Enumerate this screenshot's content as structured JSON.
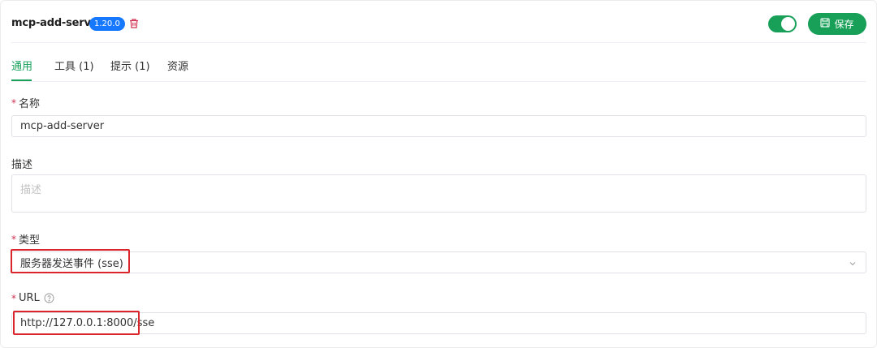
{
  "header": {
    "server_name": "mcp-add-server",
    "version": "1.20.0",
    "save_label": "保存",
    "enabled": true
  },
  "tabs": [
    {
      "label": "通用",
      "active": true
    },
    {
      "label": "工具 (1)",
      "active": false
    },
    {
      "label": "提示 (1)",
      "active": false
    },
    {
      "label": "资源",
      "active": false
    }
  ],
  "form": {
    "name": {
      "label": "名称",
      "required": true,
      "value": "mcp-add-server"
    },
    "description": {
      "label": "描述",
      "required": false,
      "placeholder": "描述",
      "value": ""
    },
    "type": {
      "label": "类型",
      "required": true,
      "value": "服务器发送事件 (sse)"
    },
    "url": {
      "label": "URL",
      "required": true,
      "value": "http://127.0.0.1:8000/sse"
    }
  },
  "colors": {
    "accent": "#18a058",
    "badge": "#1677ff",
    "danger": "#d03050",
    "highlight_box": "#d9252b"
  },
  "icons": {
    "delete": "trash-icon",
    "save": "save-icon",
    "help": "question-circle-icon",
    "dropdown": "chevron-down-icon"
  }
}
